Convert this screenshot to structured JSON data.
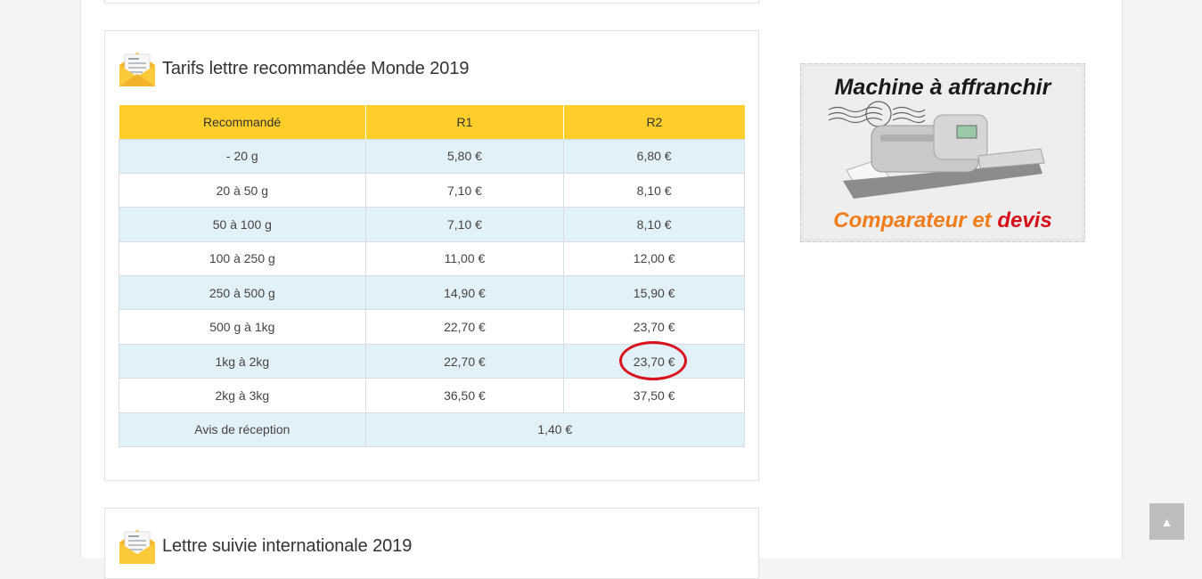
{
  "section_main": {
    "title": "Tarifs lettre recommandée Monde 2019",
    "table": {
      "headers": [
        "Recommandé",
        "R1",
        "R2"
      ],
      "rows": [
        [
          "- 20 g",
          "5,80 €",
          "6,80 €"
        ],
        [
          "20 à 50 g",
          "7,10 €",
          "8,10 €"
        ],
        [
          "50 à 100 g",
          "7,10 €",
          "8,10 €"
        ],
        [
          "100 à 250 g",
          "11,00 €",
          "12,00 €"
        ],
        [
          "250 à 500 g",
          "14,90 €",
          "15,90 €"
        ],
        [
          "500 g à 1kg",
          "22,70 €",
          "23,70 €"
        ],
        [
          "1kg à 2kg",
          "22,70 €",
          "23,70 €"
        ],
        [
          "2kg à 3kg",
          "36,50 €",
          "37,50 €"
        ]
      ],
      "footer_row": [
        "Avis de réception",
        "1,40 €"
      ]
    }
  },
  "section_next": {
    "title": "Lettre suivie internationale 2019"
  },
  "ad": {
    "line1": "Machine à affranchir",
    "line2_a": "Comparateur et",
    "line2_b": "devis"
  },
  "scroll_top": {
    "symbol": "▲"
  },
  "colors": {
    "header_yellow": "#ffce2b",
    "row_blue": "#e2f0f8",
    "circle_red": "#d9121e",
    "ad_orange": "#f07d1a",
    "ad_red": "#d6101a"
  }
}
